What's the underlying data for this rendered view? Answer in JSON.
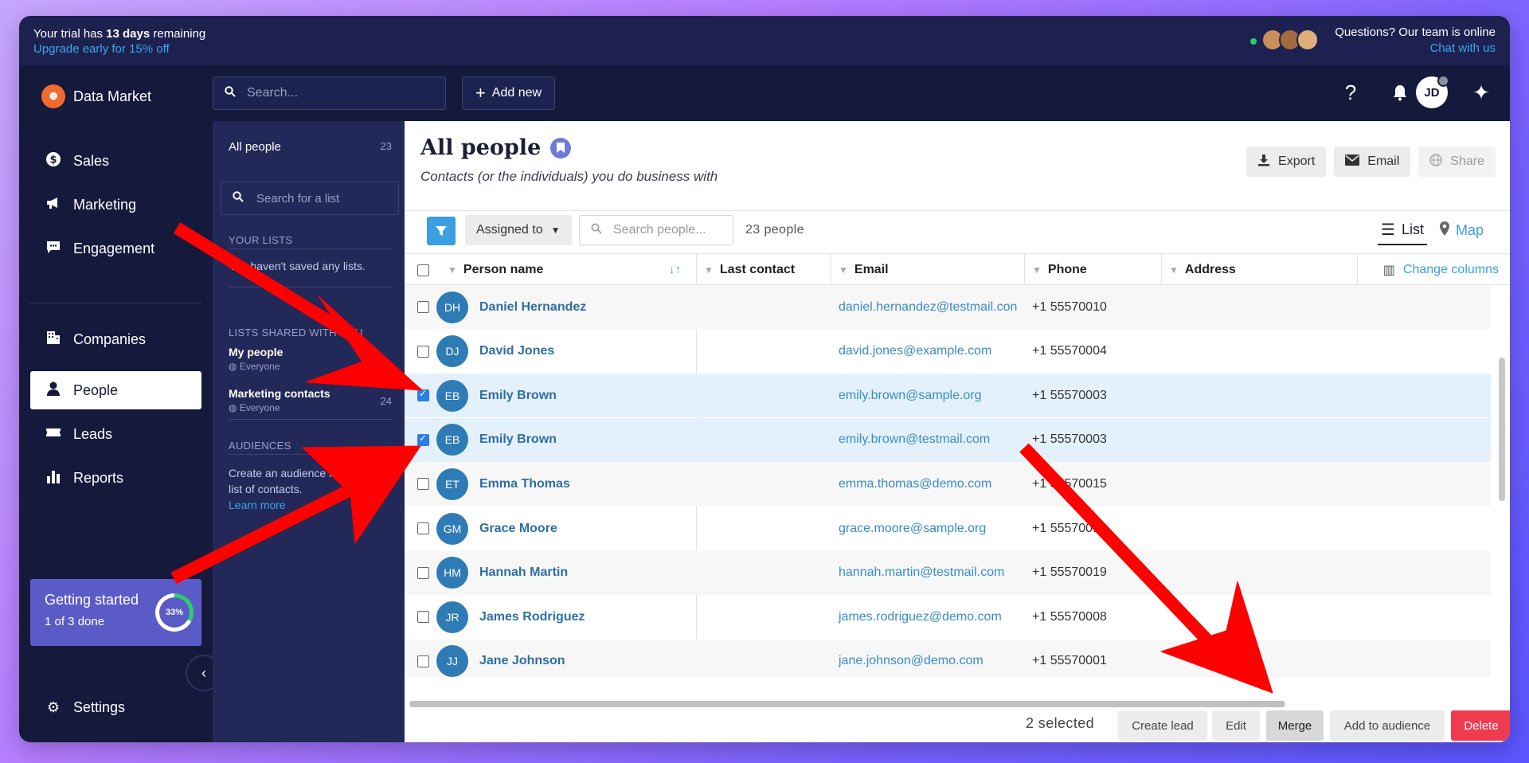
{
  "trial": {
    "prefix": "Your trial has ",
    "days": "13 days",
    "suffix": " remaining",
    "upgrade": "Upgrade early for 15% off",
    "questions": "Questions? Our team is online",
    "chat": "Chat with us"
  },
  "topbar": {
    "brand": "Data Market",
    "search_placeholder": "Search...",
    "add_new": "Add new",
    "avatar_initials": "JD"
  },
  "sidebar": {
    "items": [
      {
        "label": "Sales",
        "icon": "dollar-icon"
      },
      {
        "label": "Marketing",
        "icon": "megaphone-icon"
      },
      {
        "label": "Engagement",
        "icon": "chat-icon"
      },
      {
        "label": "Companies",
        "icon": "building-icon"
      },
      {
        "label": "People",
        "icon": "person-icon",
        "active": true
      },
      {
        "label": "Leads",
        "icon": "ticket-icon"
      },
      {
        "label": "Reports",
        "icon": "bar-chart-icon"
      }
    ],
    "getting_started": {
      "title": "Getting started",
      "sub": "1 of 3 done",
      "progress": "33%"
    },
    "settings": "Settings"
  },
  "lists": {
    "all_people": "All people",
    "all_people_count": "23",
    "search_placeholder": "Search for a list",
    "your_lists_heading": "YOUR LISTS",
    "your_lists_empty": "You haven't saved any lists.",
    "shared_heading": "LISTS SHARED WITH YOU",
    "shared": [
      {
        "name": "My people",
        "scope": "Everyone",
        "count": ""
      },
      {
        "name": "Marketing contacts",
        "scope": "Everyone",
        "count": "24"
      }
    ],
    "audiences_heading": "AUDIENCES",
    "audiences_text_1": "Create an audience from a",
    "audiences_text_2": "list of contacts.",
    "audiences_link": "Learn more"
  },
  "main": {
    "title": "All people",
    "subtitle": "Contacts (or the individuals) you do business with",
    "export": "Export",
    "email": "Email",
    "share": "Share",
    "assigned_to": "Assigned to",
    "search_placeholder": "Search people...",
    "people_count": "23 people",
    "view_list": "List",
    "view_map": "Map",
    "columns": [
      "Person name",
      "Last contact",
      "Email",
      "Phone",
      "Address"
    ],
    "change_columns": "Change columns",
    "rows": [
      {
        "initials": "DH",
        "name": "Daniel Hernandez",
        "email": "daniel.hernandez@testmail.con",
        "phone": "+1 55570010",
        "checked": false
      },
      {
        "initials": "DJ",
        "name": "David Jones",
        "email": "david.jones@example.com",
        "phone": "+1 55570004",
        "checked": false
      },
      {
        "initials": "EB",
        "name": "Emily Brown",
        "email": "emily.brown@sample.org",
        "phone": "+1 55570003",
        "checked": true
      },
      {
        "initials": "EB",
        "name": "Emily Brown",
        "email": "emily.brown@testmail.com",
        "phone": "+1 55570003",
        "checked": true
      },
      {
        "initials": "ET",
        "name": "Emma Thomas",
        "email": "emma.thomas@demo.com",
        "phone": "+1 55570015",
        "checked": false
      },
      {
        "initials": "GM",
        "name": "Grace Moore",
        "email": "grace.moore@sample.org",
        "phone": "+1 55570012",
        "checked": false
      },
      {
        "initials": "HM",
        "name": "Hannah Martin",
        "email": "hannah.martin@testmail.com",
        "phone": "+1 55570019",
        "checked": false
      },
      {
        "initials": "JR",
        "name": "James Rodriguez",
        "email": "james.rodriguez@demo.com",
        "phone": "+1 55570008",
        "checked": false
      },
      {
        "initials": "JJ",
        "name": "Jane Johnson",
        "email": "jane.johnson@demo.com",
        "phone": "+1 55570001",
        "checked": false
      }
    ],
    "selected_count": "2 selected",
    "actions": {
      "create_lead": "Create lead",
      "edit": "Edit",
      "merge": "Merge",
      "add_to_audience": "Add to audience",
      "delete": "Delete"
    }
  },
  "colors": {
    "nav_bg": "#151a3d",
    "panel_bg": "#222858",
    "accent": "#3aa0e0",
    "delete": "#ef3b50",
    "arrow": "#ff0000"
  }
}
